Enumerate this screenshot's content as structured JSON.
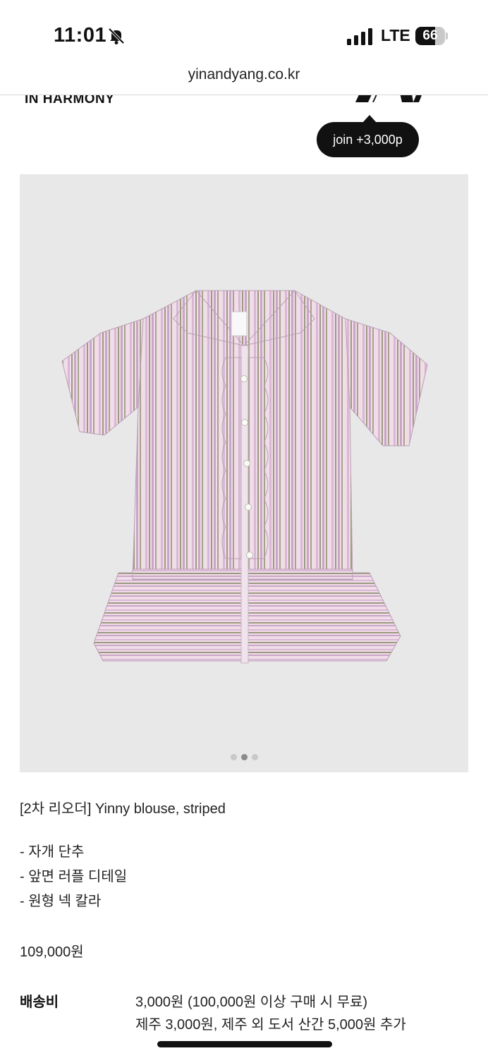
{
  "status_bar": {
    "time": "11:01",
    "carrier": "LTE",
    "battery_level": 66,
    "battery_text": "66",
    "icons": [
      "bell-slash-icon",
      "signal-bars-icon",
      "battery-icon"
    ]
  },
  "browser": {
    "url": "yinandyang.co.kr"
  },
  "site_header": {
    "brand_subtitle": "IN HARMONY",
    "menu_icon": "hamburger-menu-icon"
  },
  "join_tooltip": {
    "label": "join +3,000p"
  },
  "carousel": {
    "total_slides": 3,
    "active_slide": 2
  },
  "product": {
    "title": "[2차 리오더] Yinny blouse, striped",
    "features": [
      "- 자개 단추",
      "- 앞면 러플 디테일",
      "- 원형 넥 칼라"
    ],
    "price": "109,000원",
    "shipping": {
      "label": "배송비",
      "line1": "3,000원 (100,000원 이상 구매 시 무료)",
      "line2": "제주 3,000원, 제주 외 도서 산간 5,000원 추가"
    }
  },
  "colors": {
    "image_background": "#e8e8e9",
    "stripe_pink": "#d9b7d6",
    "stripe_olive": "#9a9a80",
    "tooltip_bg": "#111111"
  }
}
